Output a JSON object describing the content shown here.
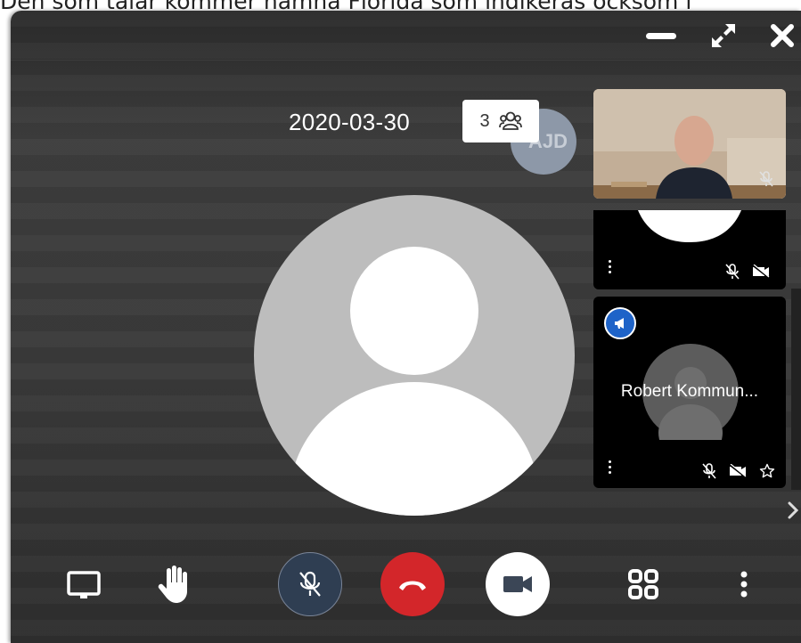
{
  "background_caption": "Den som talar kommer nämna Florida som indikeras ocksom i",
  "meeting": {
    "date": "2020-03-30",
    "participant_count": "3",
    "avatar_initials": "AJD"
  },
  "participants": [
    {
      "type": "video"
    },
    {
      "type": "avatar"
    },
    {
      "name": "Robert Kommun..."
    }
  ],
  "icons": {
    "minimize": "minimize-icon",
    "expand": "expand-icon",
    "close": "close-icon",
    "participants": "people-group-icon",
    "screen_share": "monitor-icon",
    "raise_hand": "hand-icon",
    "mic": "mic-off-icon",
    "hangup": "phone-hangup-icon",
    "camera": "video-camera-icon",
    "layout": "grid-layout-icon",
    "more": "more-vertical-icon"
  },
  "colors": {
    "hangup": "#d3262a",
    "mic_button": "#2f3e52",
    "speaker_badge": "#1e63c8"
  }
}
